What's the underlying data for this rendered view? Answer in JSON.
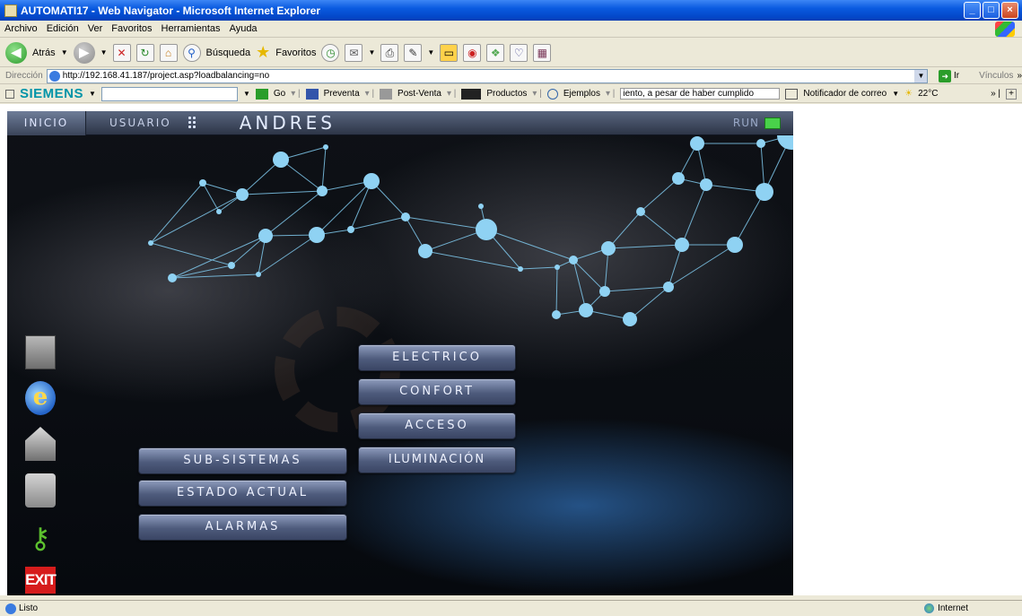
{
  "window": {
    "title": "AUTOMATI17 - Web Navigator - Microsoft Internet Explorer",
    "controls": {
      "minimize": "_",
      "maximize": "□",
      "close": "×"
    }
  },
  "menubar": [
    "Archivo",
    "Edición",
    "Ver",
    "Favoritos",
    "Herramientas",
    "Ayuda"
  ],
  "toolbar": {
    "back_label": "Atrás",
    "search_label": "Búsqueda",
    "favorites_label": "Favoritos"
  },
  "addressbar": {
    "label": "Dirección",
    "url": "http://192.168.41.187/project.asp?loadbalancing=no",
    "go_label": "Ir",
    "links_label": "Vínculos"
  },
  "siemensbar": {
    "brand": "SIEMENS",
    "go_label": "Go",
    "items": [
      "Preventa",
      "Post-Venta",
      "Productos",
      "Ejemplos"
    ],
    "ticker": "iento, a pesar de haber cumplido",
    "notifier": "Notificador de correo",
    "temperature": "22°C"
  },
  "scada": {
    "nav": {
      "home": "INICIO",
      "user_label": "USUARIO",
      "user_name": "ANDRES",
      "run_label": "RUN"
    },
    "run_status_color": "#49d24a",
    "menu_right": [
      "ELECTRICO",
      "CONFORT",
      "ACCESO",
      "ILUMINACIÓN"
    ],
    "menu_left": [
      "SUB-SISTEMAS",
      "ESTADO ACTUAL",
      "ALARMAS"
    ],
    "exit_label": "EXIT",
    "left_icons": [
      "camera-icon",
      "internet-explorer-icon",
      "house-icon",
      "user-icon",
      "key-icon",
      "exit-icon"
    ]
  },
  "statusbar": {
    "text": "Listo",
    "zone": "Internet"
  }
}
